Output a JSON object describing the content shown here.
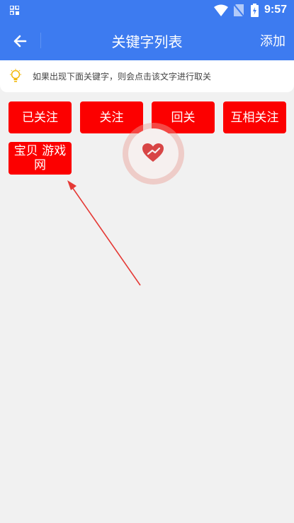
{
  "status_bar": {
    "time": "9:57",
    "icons": [
      "grid-icon",
      "wifi-icon",
      "no-sim-icon",
      "battery-charging-icon"
    ]
  },
  "app_bar": {
    "title": "关键字列表",
    "add_label": "添加",
    "back_icon": "arrow-left-icon"
  },
  "tip": {
    "icon": "lightbulb-icon",
    "text": "如果出现下面关键字，则会点击该文字进行取关"
  },
  "keywords": [
    {
      "label": "已关注"
    },
    {
      "label": "关注"
    },
    {
      "label": "回关"
    },
    {
      "label": "互相关注"
    },
    {
      "label": "宝贝 游戏网"
    }
  ],
  "floating_button": {
    "icon": "heart-icon"
  },
  "colors": {
    "primary": "#3d7bf0",
    "keyword_bg": "#fc0000",
    "background": "#f1f1f1",
    "annotation_arrow": "#e53935"
  }
}
